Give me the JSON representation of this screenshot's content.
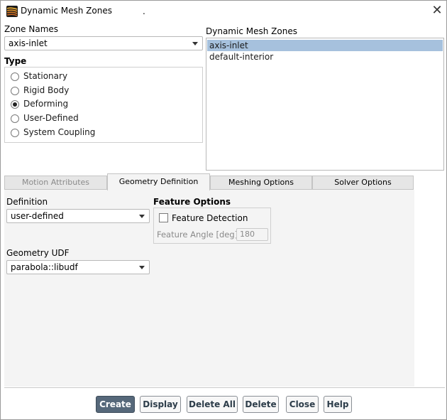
{
  "window": {
    "title": "Dynamic Mesh Zones",
    "title_suffix": "."
  },
  "zone_names": {
    "label": "Zone Names",
    "value": "axis-inlet"
  },
  "type": {
    "label": "Type",
    "options": [
      "Stationary",
      "Rigid Body",
      "Deforming",
      "User-Defined",
      "System Coupling"
    ],
    "selected": "Deforming"
  },
  "dynamic_mesh_zones": {
    "label": "Dynamic Mesh Zones",
    "items": [
      "axis-inlet",
      "default-interior"
    ],
    "selected": "axis-inlet"
  },
  "tabs": [
    "Motion Attributes",
    "Geometry Definition",
    "Meshing Options",
    "Solver Options"
  ],
  "active_tab": "Geometry Definition",
  "geometry": {
    "definition_label": "Definition",
    "definition_value": "user-defined",
    "udf_label": "Geometry UDF",
    "udf_value": "parabola::libudf"
  },
  "feature_options": {
    "label": "Feature Options",
    "detection_label": "Feature Detection",
    "detection_checked": false,
    "angle_label": "Feature Angle [deg]",
    "angle_value": "180"
  },
  "buttons": {
    "create": "Create",
    "display": "Display",
    "delete_all": "Delete All",
    "delete": "Delete",
    "close": "Close",
    "help": "Help"
  },
  "icons": {
    "app": "fluent-app-icon",
    "close": "close-icon"
  }
}
